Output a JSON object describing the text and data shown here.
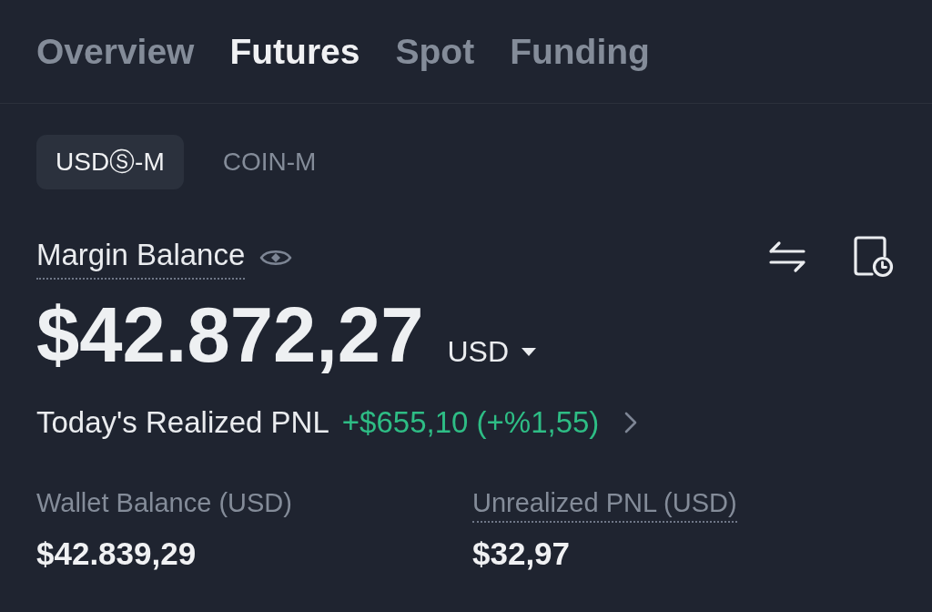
{
  "tabs": [
    {
      "label": "Overview",
      "selected": false
    },
    {
      "label": "Futures",
      "selected": true
    },
    {
      "label": "Spot",
      "selected": false
    },
    {
      "label": "Funding",
      "selected": false
    }
  ],
  "sub_tabs": [
    {
      "label": "USDⓈ-M",
      "selected": true
    },
    {
      "label": "COIN-M",
      "selected": false
    }
  ],
  "margin_balance": {
    "label": "Margin Balance",
    "tooltip": true,
    "amount": "$42.872,27",
    "currency": "USD"
  },
  "realized_pnl": {
    "label": "Today's Realized PNL",
    "value": "+$655,10 (+%1,55)"
  },
  "stats": [
    {
      "label": "Wallet Balance (USD)",
      "tooltip": false,
      "value": "$42.839,29"
    },
    {
      "label": "Unrealized PNL (USD)",
      "tooltip": true,
      "value": "$32,97"
    }
  ]
}
